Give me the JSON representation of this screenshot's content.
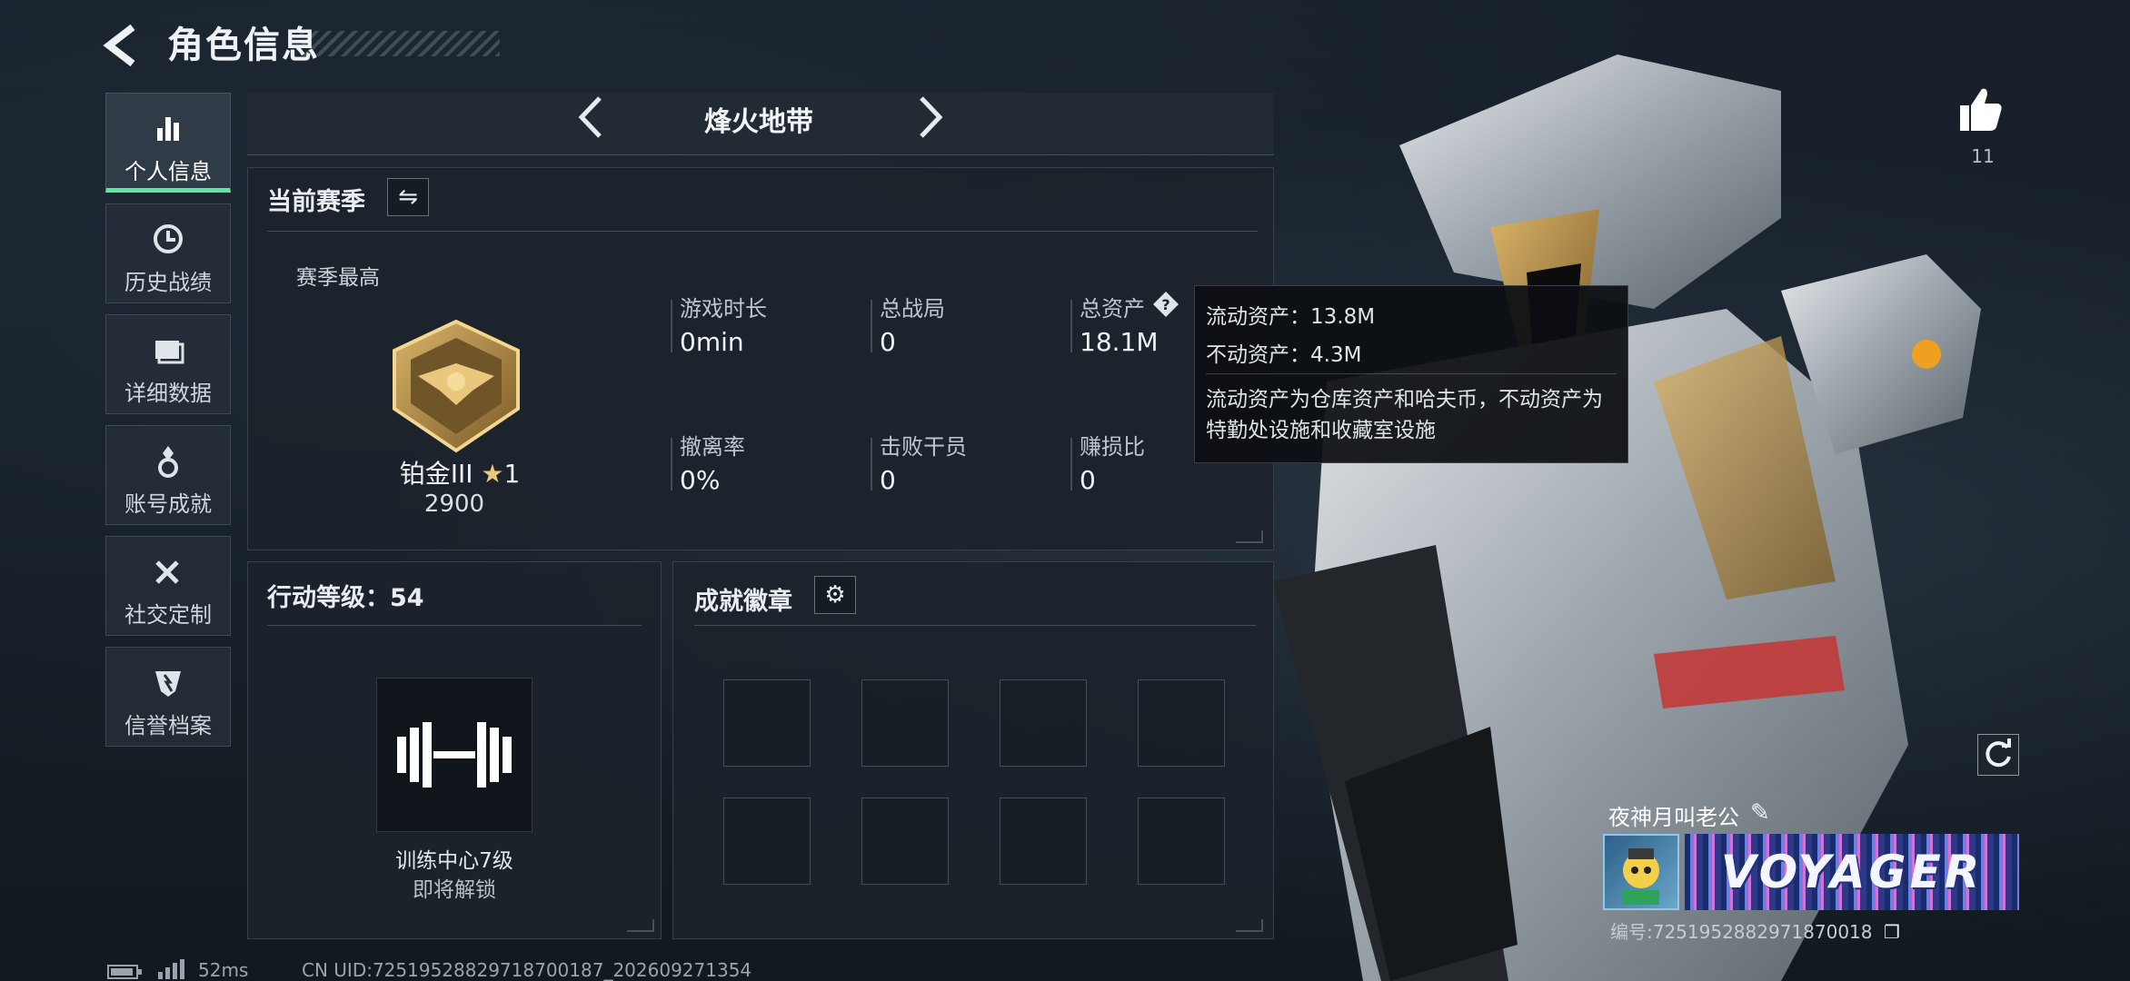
{
  "header": {
    "title": "角色信息"
  },
  "sidebar": {
    "items": [
      {
        "label": "个人信息",
        "icon": "bar-chart-icon",
        "active": true
      },
      {
        "label": "历史战绩",
        "icon": "clock-icon"
      },
      {
        "label": "详细数据",
        "icon": "folder-icon"
      },
      {
        "label": "账号成就",
        "icon": "medal-icon"
      },
      {
        "label": "社交定制",
        "icon": "tools-icon"
      },
      {
        "label": "信誉档案",
        "icon": "shield-icon"
      }
    ]
  },
  "mode_selector": {
    "current": "烽火地带"
  },
  "season": {
    "title": "当前赛季",
    "highest_label": "赛季最高",
    "rank_name": "铂金III",
    "rank_stars": "1",
    "rank_score": "2900",
    "stats": [
      {
        "label": "游戏时长",
        "value": "0min"
      },
      {
        "label": "总战局",
        "value": "0"
      },
      {
        "label": "总资产",
        "value": "18.1M"
      },
      {
        "label": "撤离率",
        "value": "0%"
      },
      {
        "label": "击败干员",
        "value": "0"
      },
      {
        "label": "赚损比",
        "value": "0"
      }
    ]
  },
  "tooltip": {
    "liquid": "流动资产：13.8M",
    "fixed": "不动资产：4.3M",
    "note": "流动资产为仓库资产和哈夫币，不动资产为特勤处设施和收藏室设施"
  },
  "level": {
    "title": "行动等级：54",
    "unlock_name": "训练中心7级",
    "unlock_status": "即将解锁"
  },
  "badges": {
    "title": "成就徽章"
  },
  "profile": {
    "likes": "11",
    "name": "夜神月叫老公",
    "banner_text": "VOYAGER",
    "id_text": "编号:7251952882971870018"
  },
  "status": {
    "ping": "52ms",
    "uid": "CN UID:72519528829718700187_202609271354"
  },
  "colors": {
    "accent": "#5ee5a0",
    "panel": "#1c232b"
  }
}
